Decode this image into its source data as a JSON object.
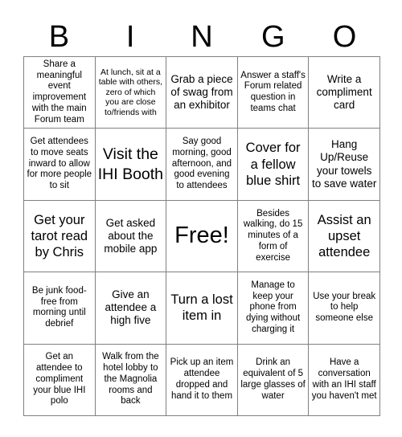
{
  "card": {
    "title_letters": [
      "B",
      "I",
      "N",
      "G",
      "O"
    ],
    "colors": {
      "background": "#ffffff",
      "text": "#000000",
      "grid_line": "#808080"
    },
    "rows": [
      [
        {
          "text": "Share a meaningful event improvement with the main Forum team",
          "size": "s"
        },
        {
          "text": "At lunch, sit at a table with others, zero of which you are close to/friends with",
          "size": "xs"
        },
        {
          "text": "Grab a piece of swag from an exhibitor",
          "size": "m"
        },
        {
          "text": "Answer a staff's Forum related question in teams chat",
          "size": "s"
        },
        {
          "text": "Write a compliment card",
          "size": "m"
        }
      ],
      [
        {
          "text": "Get attendees to move seats inward to allow for more people to sit",
          "size": "s"
        },
        {
          "text": "Visit the IHI Booth",
          "size": "xl"
        },
        {
          "text": "Say good morning, good afternoon, and good evening to attendees",
          "size": "s"
        },
        {
          "text": "Cover for a fellow blue shirt",
          "size": "l"
        },
        {
          "text": "Hang Up/Reuse your towels to save water",
          "size": "m"
        }
      ],
      [
        {
          "text": "Get your tarot read by Chris",
          "size": "l"
        },
        {
          "text": "Get asked about the mobile app",
          "size": "m"
        },
        {
          "text": "Free!",
          "size": "free"
        },
        {
          "text": "Besides walking, do 15 minutes of a form of exercise",
          "size": "s"
        },
        {
          "text": "Assist an upset attendee",
          "size": "l"
        }
      ],
      [
        {
          "text": "Be junk food-free from morning until debrief",
          "size": "s"
        },
        {
          "text": "Give an attendee a high five",
          "size": "m"
        },
        {
          "text": "Turn a lost item in",
          "size": "l"
        },
        {
          "text": "Manage to keep your phone from dying without charging it",
          "size": "s"
        },
        {
          "text": "Use your break to help someone else",
          "size": "s"
        }
      ],
      [
        {
          "text": "Get an attendee to compliment your blue IHI polo",
          "size": "s"
        },
        {
          "text": "Walk from the hotel lobby to the Magnolia rooms and back",
          "size": "s"
        },
        {
          "text": "Pick up an item attendee dropped and hand it to them",
          "size": "s"
        },
        {
          "text": "Drink an equivalent of 5 large glasses of water",
          "size": "s"
        },
        {
          "text": "Have a conversation with an IHI staff you haven't met",
          "size": "s"
        }
      ]
    ]
  }
}
